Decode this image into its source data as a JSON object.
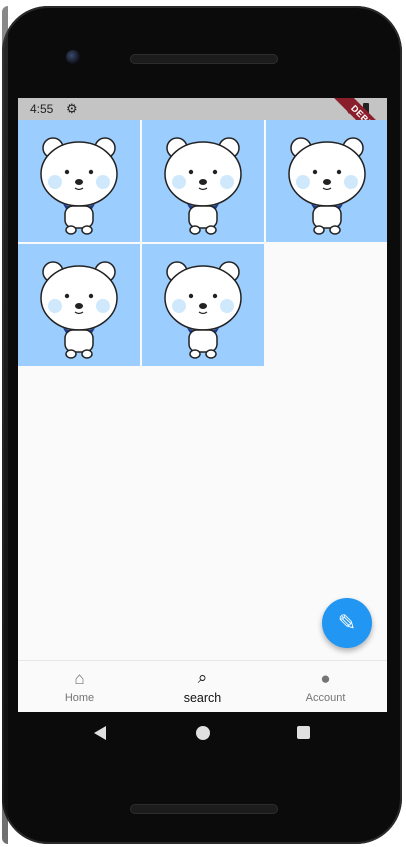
{
  "status": {
    "time": "4:55",
    "settings_icon": "gear-icon",
    "wifi_icon": "wifi-icon",
    "battery_icon": "battery-icon"
  },
  "debug_banner": {
    "label": "DEBUG",
    "color": "#8b1e2b"
  },
  "grid": {
    "tile_background": "#9ccdff",
    "tiles": [
      {
        "image": "bear-illustration"
      },
      {
        "image": "bear-illustration"
      },
      {
        "image": "bear-illustration"
      },
      {
        "image": "bear-illustration"
      },
      {
        "image": "bear-illustration"
      }
    ]
  },
  "fab": {
    "icon": "pencil-icon",
    "color": "#2196f3"
  },
  "bottom_nav": {
    "items": [
      {
        "label": "Home",
        "icon": "home-icon",
        "active": false
      },
      {
        "label": "search",
        "icon": "search-icon",
        "active": true
      },
      {
        "label": "Account",
        "icon": "account-icon",
        "active": false
      }
    ]
  },
  "system_nav": {
    "back_icon": "back-icon",
    "home_icon": "home-circle-icon",
    "recents_icon": "recents-icon"
  }
}
